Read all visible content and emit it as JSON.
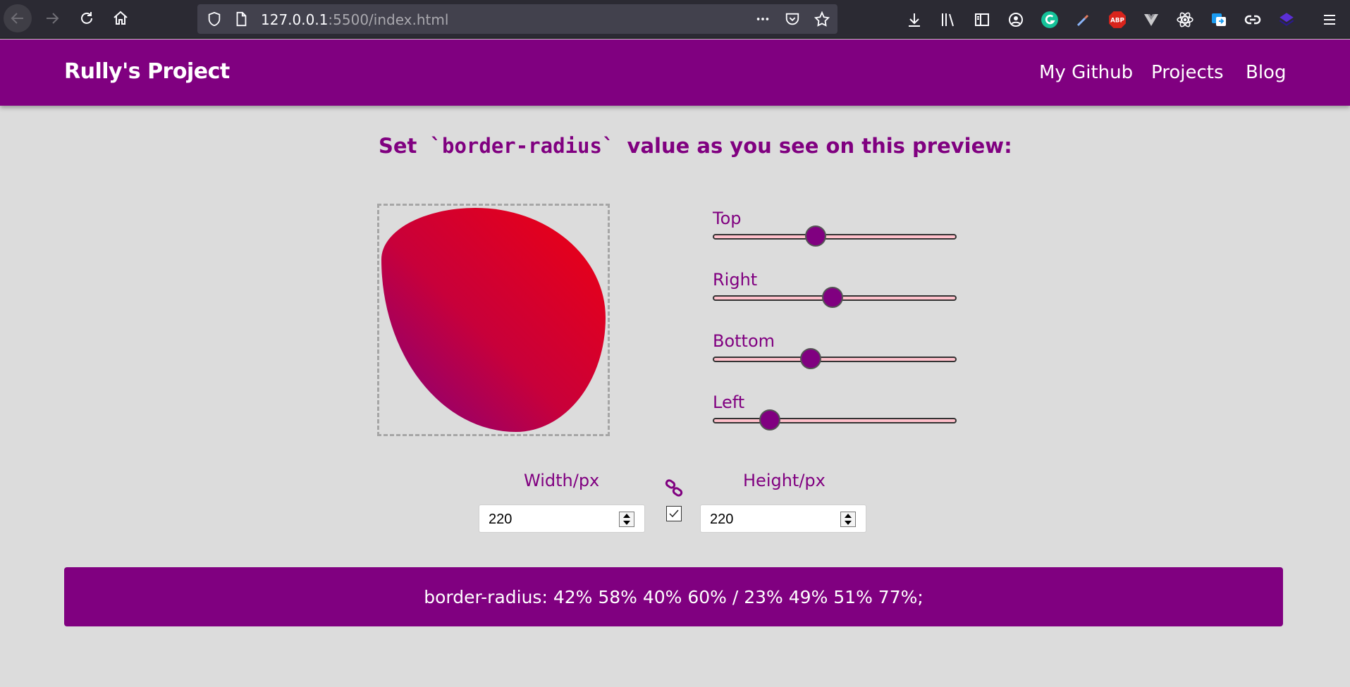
{
  "browser": {
    "url_host": "127.0.0.1",
    "url_rest": ":5500/index.html",
    "toolbar_icons": [
      "download-icon",
      "library-icon",
      "sidebar-icon",
      "account-icon",
      "grammarly-icon",
      "eyedropper-icon",
      "adblock-plus-icon",
      "vue-devtools-icon",
      "react-devtools-icon",
      "translate-icon",
      "link-icon",
      "extension-icon",
      "menu-icon"
    ],
    "adblock_label": "ABP"
  },
  "navbar": {
    "brand": "Rully's Project",
    "links": [
      "My Github",
      "Projects",
      "Blog"
    ]
  },
  "heading": {
    "prefix": "Set",
    "code": "`border-radius`",
    "suffix": "value as you see on this preview:"
  },
  "preview": {
    "border_radius": "42% 58% 40% 60% / 23% 49% 51% 77%"
  },
  "sliders": [
    {
      "label": "Top",
      "value": 42
    },
    {
      "label": "Right",
      "value": 49
    },
    {
      "label": "Bottom",
      "value": 40
    },
    {
      "label": "Left",
      "value": 23
    }
  ],
  "dimensions": {
    "width_label": "Width/px",
    "height_label": "Height/px",
    "width_value": "220",
    "height_value": "220",
    "linked": true
  },
  "result": {
    "text": "border-radius: 42% 58% 40% 60% / 23% 49% 51% 77%;"
  },
  "colors": {
    "accent": "#800080",
    "track": "#ffc0cb",
    "background": "#dcdcdc"
  }
}
